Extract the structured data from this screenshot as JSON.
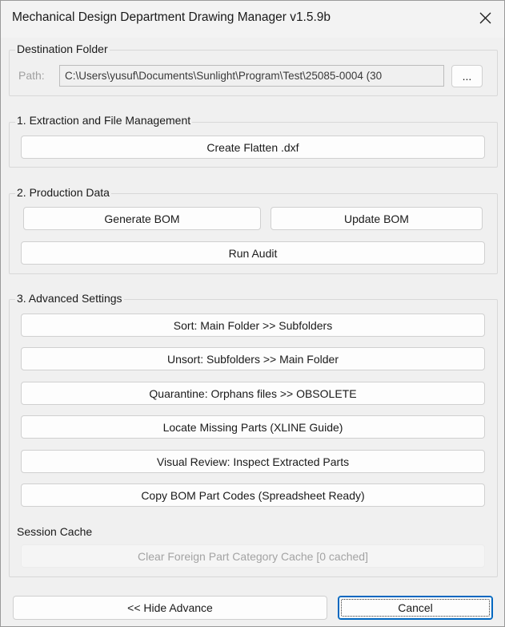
{
  "window": {
    "title": "Mechanical Design Department Drawing Manager v1.5.9b"
  },
  "destination": {
    "group_label": "Destination Folder",
    "path_label": "Path:",
    "path_value": "C:\\Users\\yusuf\\Documents\\Sunlight\\Program\\Test\\25085-0004 (30",
    "browse_label": "..."
  },
  "extraction": {
    "group_label": "1. Extraction and File Management",
    "create_flatten_label": "Create Flatten .dxf"
  },
  "production": {
    "group_label": "2. Production Data",
    "generate_bom_label": "Generate BOM",
    "update_bom_label": "Update BOM",
    "run_audit_label": "Run Audit"
  },
  "advanced": {
    "group_label": "3. Advanced Settings",
    "sort_label": "Sort: Main Folder >> Subfolders",
    "unsort_label": "Unsort: Subfolders >> Main Folder",
    "quarantine_label": "Quarantine: Orphans files >> OBSOLETE",
    "locate_missing_label": "Locate Missing Parts (XLINE Guide)",
    "visual_review_label": "Visual Review: Inspect Extracted Parts",
    "copy_bom_label": "Copy BOM Part Codes (Spreadsheet Ready)",
    "session_cache_label": "Session Cache",
    "clear_cache_label": "Clear Foreign Part Category Cache  [0 cached]"
  },
  "footer": {
    "hide_advance_label": "<< Hide Advance",
    "cancel_label": "Cancel"
  },
  "colors": {
    "window_bg": "#f0f0f0",
    "focus_accent": "#0067c0",
    "disabled_text": "#a3a3a3"
  }
}
